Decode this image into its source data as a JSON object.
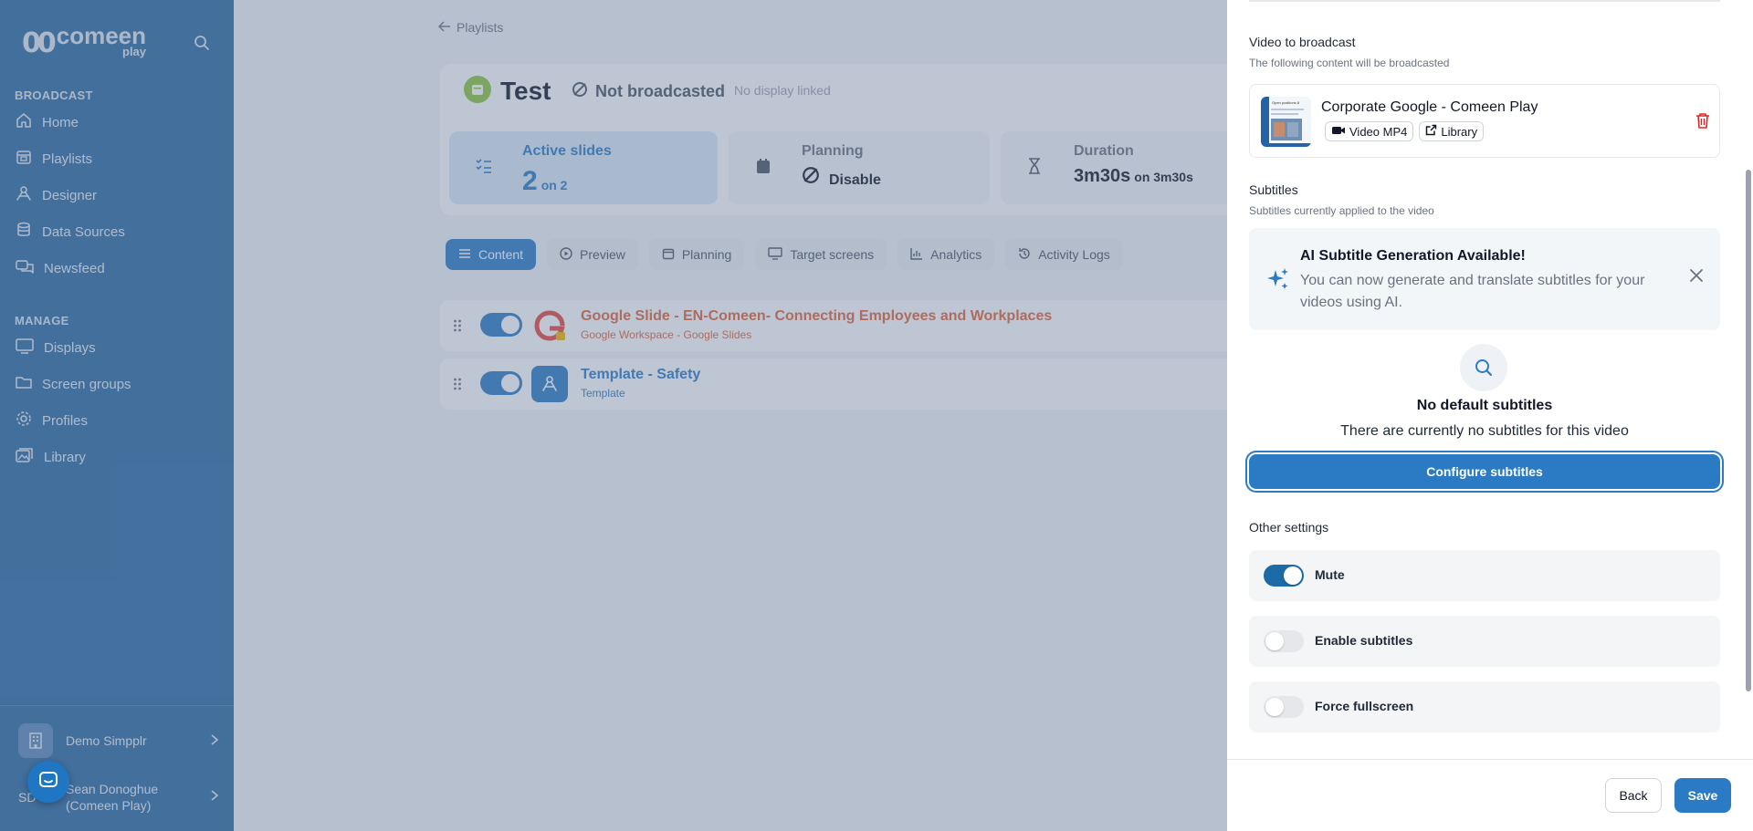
{
  "sidebar": {
    "logo_mark": "00",
    "logo_text": "comeen",
    "logo_sub": "play",
    "broadcast_heading": "BROADCAST",
    "broadcast_items": [
      {
        "label": "Home"
      },
      {
        "label": "Playlists"
      },
      {
        "label": "Designer"
      },
      {
        "label": "Data Sources"
      },
      {
        "label": "Newsfeed"
      }
    ],
    "manage_heading": "MANAGE",
    "manage_items": [
      {
        "label": "Displays"
      },
      {
        "label": "Screen groups"
      },
      {
        "label": "Profiles"
      },
      {
        "label": "Library"
      }
    ],
    "org_name": "Demo Simpplr",
    "user_initials": "SD",
    "user_name_line1": "Sean Donoghue",
    "user_name_line2": "(Comeen Play)"
  },
  "main": {
    "breadcrumb": "Playlists",
    "playlist_title": "Test",
    "status": "Not broadcasted",
    "display_status": "No display linked",
    "stats": [
      {
        "label": "Active slides",
        "value": "2",
        "suffix": "on 2"
      },
      {
        "label": "Planning",
        "value": "Disable",
        "suffix": ""
      },
      {
        "label": "Duration",
        "value": "3m30s",
        "suffix": "on 3m30s"
      }
    ],
    "tabs": [
      "Content",
      "Preview",
      "Planning",
      "Target screens",
      "Analytics",
      "Activity Logs"
    ],
    "rows": [
      {
        "title": "Google Slide - EN-Comeen- Connecting Employees and Workplaces",
        "subtitle": "Google Workspace - Google Slides"
      },
      {
        "title": "Template - Safety",
        "subtitle": "Template"
      }
    ]
  },
  "drawer": {
    "video_heading": "Video to broadcast",
    "video_sub": "The following content will be broadcasted",
    "video": {
      "title": "Corporate Google - Comeen Play",
      "tag_type": "Video MP4",
      "tag_source": "Library",
      "thumb_caption": "Open positions 8"
    },
    "subtitles_heading": "Subtitles",
    "subtitles_sub": "Subtitles currently applied to the video",
    "ai_title": "AI Subtitle Generation Available!",
    "ai_text": "You can now generate and translate subtitles for your videos using AI.",
    "empty_title": "No default subtitles",
    "empty_text": "There are currently no subtitles for this video",
    "configure_button": "Configure subtitles",
    "other_heading": "Other settings",
    "settings": [
      {
        "label": "Mute",
        "on": true
      },
      {
        "label": "Enable subtitles",
        "on": false
      },
      {
        "label": "Force fullscreen",
        "on": false
      }
    ],
    "back_button": "Back",
    "save_button": "Save"
  },
  "colors": {
    "sidebar": "#2b6aa3",
    "accent": "#2b7bc4",
    "danger": "#dc2626",
    "google_title": "#e1653a"
  }
}
